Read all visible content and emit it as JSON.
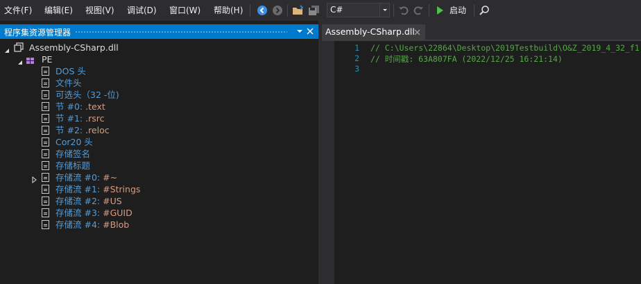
{
  "menu": {
    "items": [
      {
        "label": "文件(F)"
      },
      {
        "label": "编辑(E)"
      },
      {
        "label": "视图(V)"
      },
      {
        "label": "调试(D)"
      },
      {
        "label": "窗口(W)"
      },
      {
        "label": "帮助(H)"
      }
    ]
  },
  "toolbar": {
    "language_value": "C#",
    "start_label": "启动",
    "icons": [
      "back-icon",
      "forward-icon",
      "open-icon",
      "save-all-icon",
      "undo-icon",
      "redo-icon",
      "start-icon",
      "search-icon"
    ]
  },
  "left_panel": {
    "title": "程序集资源管理器",
    "tree": [
      {
        "label": "Assembly-CSharp.dll",
        "icon": "assembly-icon",
        "expanded": true,
        "color": "#dcdcdc"
      },
      {
        "label": "PE",
        "icon": "pe-icon",
        "expanded": true,
        "color": "#dcdcdc"
      },
      {
        "label": "DOS 头",
        "icon": "document-icon",
        "color": "#569cd6"
      },
      {
        "label": "文件头",
        "icon": "document-icon",
        "color": "#569cd6"
      },
      {
        "label": "可选头（32 -位)",
        "icon": "document-icon",
        "color": "#569cd6"
      },
      {
        "prefix": "节 #0: ",
        "value": ".text",
        "icon": "document-icon"
      },
      {
        "prefix": "节 #1: ",
        "value": ".rsrc",
        "icon": "document-icon"
      },
      {
        "prefix": "节 #2: ",
        "value": ".reloc",
        "icon": "document-icon"
      },
      {
        "label": "Cor20 头",
        "icon": "document-icon",
        "color": "#569cd6"
      },
      {
        "label": "存储签名",
        "icon": "document-icon",
        "color": "#569cd6"
      },
      {
        "label": "存储标题",
        "icon": "document-icon",
        "color": "#569cd6"
      },
      {
        "prefix": "存储流 #0: ",
        "value": "#~",
        "icon": "document-icon",
        "collapsed": true
      },
      {
        "prefix": "存储流 #1: ",
        "value": "#Strings",
        "icon": "document-icon"
      },
      {
        "prefix": "存储流 #2: ",
        "value": "#US",
        "icon": "document-icon"
      },
      {
        "prefix": "存储流 #3: ",
        "value": "#GUID",
        "icon": "document-icon"
      },
      {
        "prefix": "存储流 #4: ",
        "value": "#Blob",
        "icon": "document-icon"
      }
    ]
  },
  "editor": {
    "tab_label": "Assembly-CSharp.dll",
    "line_numbers": [
      "1",
      "2",
      "3"
    ],
    "lines": [
      "// C:\\Users\\22864\\Desktop\\2019Testbuild\\O&Z_2019_4_32_f1",
      "// 时间戳: 63A807FA (2022/12/25 16:21:14)",
      ""
    ]
  },
  "colors": {
    "accent": "#007acc",
    "comment": "#57a64a",
    "line_number": "#2b91af",
    "node_blue": "#569cd6",
    "node_orange": "#d69d85"
  }
}
